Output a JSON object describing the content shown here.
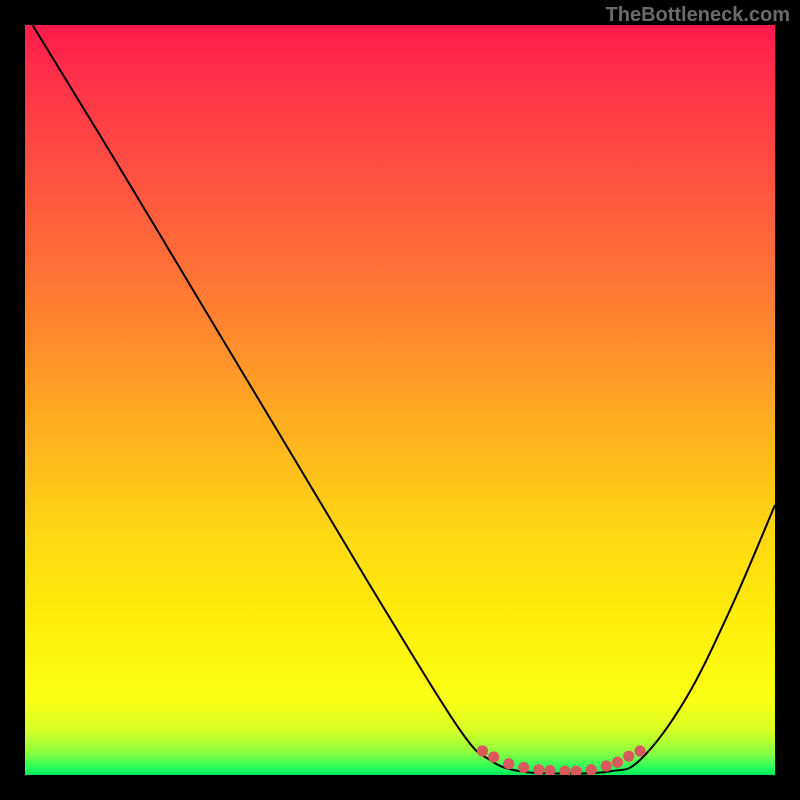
{
  "watermark": "TheBottleneck.com",
  "chart_data": {
    "type": "line",
    "title": "",
    "xlabel": "",
    "ylabel": "",
    "xlim": [
      0,
      100
    ],
    "ylim": [
      0,
      100
    ],
    "series": [
      {
        "name": "curve",
        "color": "#000000",
        "points": [
          {
            "x": 1,
            "y": 100
          },
          {
            "x": 12,
            "y": 82
          },
          {
            "x": 24,
            "y": 62
          },
          {
            "x": 36,
            "y": 42
          },
          {
            "x": 48,
            "y": 22
          },
          {
            "x": 58,
            "y": 6
          },
          {
            "x": 62,
            "y": 2
          },
          {
            "x": 66,
            "y": 0.5
          },
          {
            "x": 72,
            "y": 0.2
          },
          {
            "x": 78,
            "y": 0.5
          },
          {
            "x": 82,
            "y": 2
          },
          {
            "x": 88,
            "y": 10
          },
          {
            "x": 94,
            "y": 22
          },
          {
            "x": 100,
            "y": 36
          }
        ]
      },
      {
        "name": "dots",
        "color": "#d85a5a",
        "points": [
          {
            "x": 61,
            "y": 3.2
          },
          {
            "x": 62.5,
            "y": 2.4
          },
          {
            "x": 64.5,
            "y": 1.5
          },
          {
            "x": 66.5,
            "y": 1.0
          },
          {
            "x": 68.5,
            "y": 0.7
          },
          {
            "x": 70,
            "y": 0.6
          },
          {
            "x": 72,
            "y": 0.5
          },
          {
            "x": 73.5,
            "y": 0.5
          },
          {
            "x": 75.5,
            "y": 0.7
          },
          {
            "x": 77.5,
            "y": 1.2
          },
          {
            "x": 79,
            "y": 1.7
          },
          {
            "x": 80.5,
            "y": 2.5
          },
          {
            "x": 82,
            "y": 3.2
          }
        ]
      }
    ],
    "gradient_stops": [
      {
        "pos": 0,
        "color": "#ff1a4a"
      },
      {
        "pos": 100,
        "color": "#00e85a"
      }
    ]
  }
}
